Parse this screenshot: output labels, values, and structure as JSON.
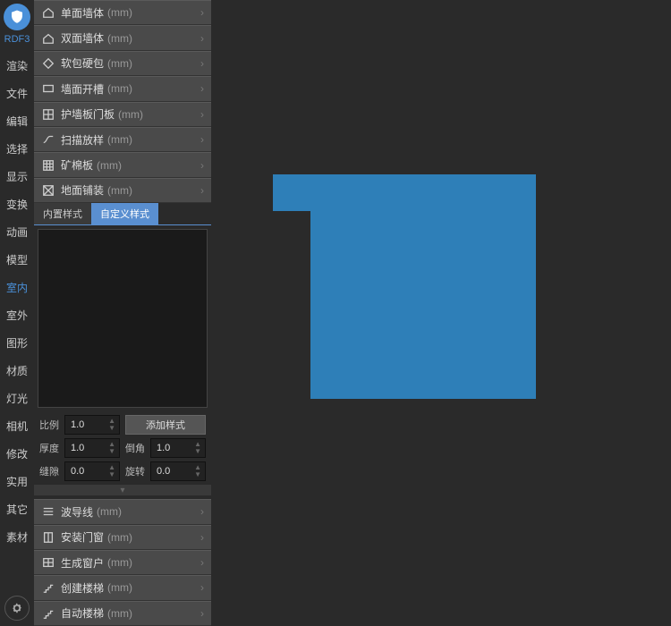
{
  "app": {
    "name": "RDF3"
  },
  "left_nav": {
    "items": [
      {
        "label": "渲染",
        "active": false
      },
      {
        "label": "文件",
        "active": false
      },
      {
        "label": "编辑",
        "active": false
      },
      {
        "label": "选择",
        "active": false
      },
      {
        "label": "显示",
        "active": false
      },
      {
        "label": "变换",
        "active": false
      },
      {
        "label": "动画",
        "active": false
      },
      {
        "label": "模型",
        "active": false
      },
      {
        "label": "室内",
        "active": true
      },
      {
        "label": "室外",
        "active": false
      },
      {
        "label": "图形",
        "active": false
      },
      {
        "label": "材质",
        "active": false
      },
      {
        "label": "灯光",
        "active": false
      },
      {
        "label": "相机",
        "active": false
      },
      {
        "label": "修改",
        "active": false
      },
      {
        "label": "实用",
        "active": false
      },
      {
        "label": "其它",
        "active": false
      },
      {
        "label": "素材",
        "active": false
      }
    ]
  },
  "accordion": {
    "unit": "(mm)",
    "top": [
      {
        "label": "单面墙体",
        "icon": "house"
      },
      {
        "label": "双面墙体",
        "icon": "house"
      },
      {
        "label": "软包硬包",
        "icon": "diamond"
      },
      {
        "label": "墙面开槽",
        "icon": "rect"
      },
      {
        "label": "护墙板门板",
        "icon": "grid"
      },
      {
        "label": "扫描放样",
        "icon": "path"
      },
      {
        "label": "矿棉板",
        "icon": "grid4"
      },
      {
        "label": "地面铺装",
        "icon": "tile"
      }
    ],
    "bottom": [
      {
        "label": "波导线",
        "icon": "lines"
      },
      {
        "label": "安装门窗",
        "icon": "window"
      },
      {
        "label": "生成窗户",
        "icon": "window2"
      },
      {
        "label": "创建楼梯",
        "icon": "stairs"
      },
      {
        "label": "自动楼梯",
        "icon": "stairs2"
      }
    ]
  },
  "tabs": {
    "builtin": "内置样式",
    "custom": "自定义样式"
  },
  "props": {
    "scale_label": "比例",
    "scale_value": "1.0",
    "add_style": "添加样式",
    "thickness_label": "厚度",
    "thickness_value": "1.0",
    "chamfer_label": "倒角",
    "chamfer_value": "1.0",
    "gap_label": "缝隙",
    "gap_value": "0.0",
    "rotate_label": "旋转",
    "rotate_value": "0.0"
  },
  "colors": {
    "accent": "#4a90d9",
    "shape": "#2e7fb8"
  }
}
